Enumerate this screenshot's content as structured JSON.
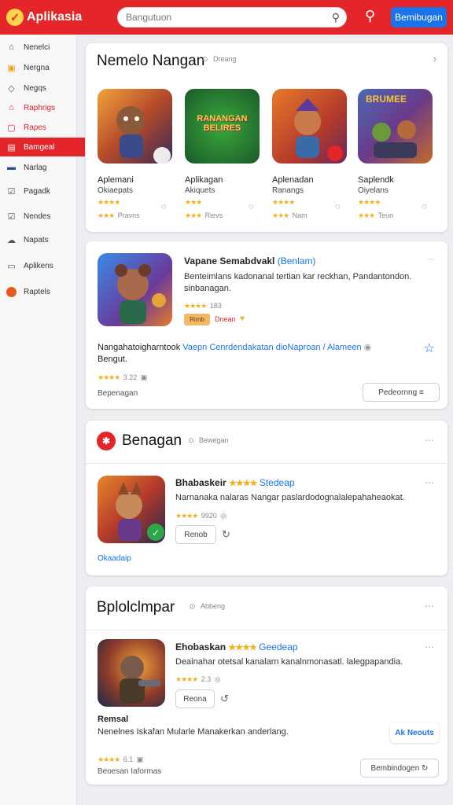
{
  "header": {
    "logo_text": "Aplikasia",
    "search_placeholder": "Bangutuon",
    "action_button": "Bemibugan"
  },
  "sidebar": {
    "items": [
      {
        "label": "Nenelci",
        "icon": "home-icon"
      },
      {
        "label": "Nergna",
        "icon": "grid-icon"
      },
      {
        "label": "Negqs",
        "icon": "tag-icon"
      },
      {
        "label": "Raphrigs",
        "icon": "bookmark-icon"
      },
      {
        "label": "Rapes",
        "icon": "star-icon"
      },
      {
        "label": "Bamgeal",
        "icon": "gamepad-icon"
      },
      {
        "label": "Narlag",
        "icon": "list-icon"
      },
      {
        "label": "Pagadk",
        "icon": "document-icon"
      },
      {
        "label": "Nendes",
        "icon": "chart-icon"
      },
      {
        "label": "Napats",
        "icon": "cloud-icon"
      },
      {
        "label": "Aplikens",
        "icon": "apps-icon"
      },
      {
        "label": "Raptels",
        "icon": "user-icon"
      }
    ]
  },
  "featured": {
    "title": "Nemelo Nangan",
    "subtitle": "Dreang",
    "apps": [
      {
        "name": "Aplemani",
        "category": "Okiaepats",
        "reviews": "Pravns"
      },
      {
        "name": "Aplikagan",
        "category": "Akiquets",
        "reviews": "Rievs"
      },
      {
        "name": "Aplenadan",
        "category": "Ranangs",
        "reviews": "Nam"
      },
      {
        "name": "Saplendk",
        "category": "Oiyelans",
        "reviews": "Teun"
      }
    ],
    "thumb_texts": {
      "app2": "RANANGAN BELIRES",
      "app4": "BRUMEE"
    }
  },
  "spotlight": {
    "title": "Vapane Semabdvakl",
    "tag": "(Benlam)",
    "description": "Benteimlans kadonanal tertian kar reckhan, Pandantondon. sinbanagan.",
    "rating_count": "183",
    "badge": "Rimb",
    "badge_note": "Dnean",
    "review_prefix": "Nangahatoigharntook",
    "review_link": "Vaepn Cenrdendakatan dioNaproan / Alameen",
    "review_suffix": "Bengut.",
    "review_rating": "3.22",
    "footer_label": "Bepenagan",
    "footer_button": "Pedeornng"
  },
  "section2": {
    "title": "Benagan",
    "subtitle": "Bewegan",
    "app_name": "Bhabaskeir",
    "app_tag": "Stedeap",
    "description": "Narnanaka nalaras Nangar paslardodognalalepahaheaokat.",
    "rating_count": "9920",
    "button": "Renob",
    "link": "Okaadaip"
  },
  "section3": {
    "title": "Bplolclmpar",
    "subtitle": "Abbeng",
    "app_name": "Ehobaskan",
    "app_tag": "Geedeap",
    "description": "Deainahar otetsal kanalarn kanalnmonasatl. lalegpapandia.",
    "rating_count": "2.3",
    "button": "Reona",
    "section_label": "Remsal",
    "section_text": "Nenelnes Iskafan Mularle Manakerkan anderlang.",
    "section_rating": "6.1",
    "footer_label": "Beoesan Iaformas",
    "footer_button": "Bembindogen",
    "float_button": "Ak Neouts"
  },
  "colors": {
    "accent": "#e4262b",
    "primary": "#1a73e8",
    "star": "#f2b01e"
  }
}
